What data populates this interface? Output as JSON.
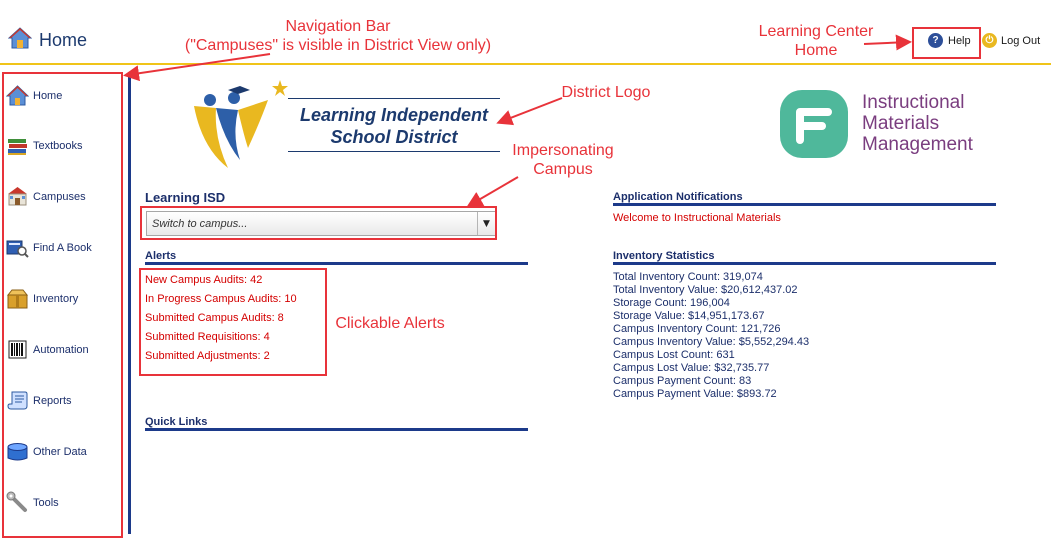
{
  "header": {
    "title": "Home",
    "help_label": "Help",
    "logout_label": "Log Out"
  },
  "sidebar": {
    "items": [
      {
        "label": "Home",
        "icon": "house-icon"
      },
      {
        "label": "Textbooks",
        "icon": "book-stack-icon"
      },
      {
        "label": "Campuses",
        "icon": "school-building-icon"
      },
      {
        "label": "Find A Book",
        "icon": "book-search-icon"
      },
      {
        "label": "Inventory",
        "icon": "boxes-icon"
      },
      {
        "label": "Automation",
        "icon": "barcode-icon"
      },
      {
        "label": "Reports",
        "icon": "scroll-icon"
      },
      {
        "label": "Other Data",
        "icon": "database-icon"
      },
      {
        "label": "Tools",
        "icon": "wrench-icon"
      }
    ]
  },
  "district_logo": {
    "line1": "Learning Independent",
    "line2": "School District"
  },
  "imm_logo": {
    "line1": "Instructional",
    "line2": "Materials",
    "line3": "Management"
  },
  "campus": {
    "title": "Learning ISD",
    "select_placeholder": "Switch to campus..."
  },
  "alerts": {
    "title": "Alerts",
    "items": [
      "New Campus Audits: 42",
      "In Progress Campus Audits: 10",
      "Submitted Campus Audits: 8",
      "Submitted Requisitions: 4",
      "Submitted Adjustments: 2"
    ]
  },
  "quick_links": {
    "title": "Quick Links"
  },
  "notifications": {
    "title": "Application Notifications",
    "message": "Welcome to Instructional Materials"
  },
  "inventory_stats": {
    "title": "Inventory Statistics",
    "items": [
      "Total Inventory Count: 319,074",
      "Total Inventory Value: $20,612,437.02",
      "Storage Count: 196,004",
      "Storage Value: $14,951,173.67",
      "Campus Inventory Count: 121,726",
      "Campus Inventory Value: $5,552,294.43",
      "Campus Lost Count: 631",
      "Campus Lost Value: $32,735.77",
      "Campus Payment Count: 83",
      "Campus Payment Value: $893.72"
    ]
  },
  "annotations": {
    "nav_bar_line1": "Navigation Bar",
    "nav_bar_line2": "(\"Campuses\" is visible in District View only)",
    "learning_center_line1": "Learning Center",
    "learning_center_line2": "Home",
    "district_logo": "District Logo",
    "impersonating_line1": "Impersonating",
    "impersonating_line2": "Campus",
    "clickable_alerts": "Clickable Alerts"
  },
  "colors": {
    "accent_red": "#e8333a",
    "navy": "#1c3a8a",
    "header_rule": "#f0c419",
    "alert_red": "#d40000",
    "imm_purple": "#7a3d7f",
    "imm_teal": "#4fb89b"
  }
}
